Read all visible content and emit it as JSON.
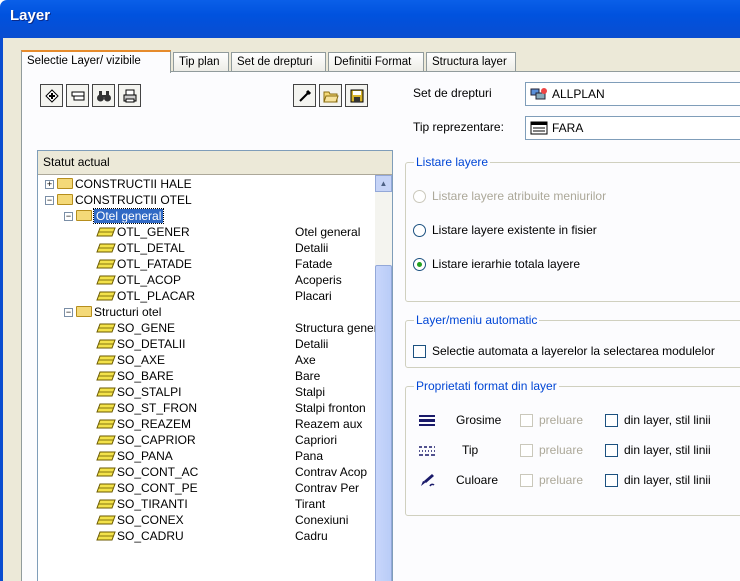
{
  "window": {
    "title": "Layer"
  },
  "tabs": [
    {
      "label": "Selectie Layer/ vizibile"
    },
    {
      "label": "Tip plan"
    },
    {
      "label": "Set de drepturi"
    },
    {
      "label": "Definitii Format"
    },
    {
      "label": "Structura layer"
    }
  ],
  "toolbar": {
    "icons": [
      "add-layer-icon",
      "list-icon",
      "binoculars-icon",
      "printer-icon",
      "eyedropper-icon",
      "open-folder-icon",
      "save-icon"
    ]
  },
  "tree": {
    "header": "Statut actual",
    "nodes": [
      {
        "label": "CONSTRUCTII HALE",
        "desc": ""
      },
      {
        "label": "CONSTRUCTII OTEL",
        "desc": ""
      },
      {
        "label": "Otel general",
        "desc": ""
      },
      {
        "label": "OTL_GENER",
        "desc": "Otel general"
      },
      {
        "label": "OTL_DETAL",
        "desc": "Detalii"
      },
      {
        "label": "OTL_FATADE",
        "desc": "Fatade"
      },
      {
        "label": "OTL_ACOP",
        "desc": "Acoperis"
      },
      {
        "label": "OTL_PLACAR",
        "desc": "Placari"
      },
      {
        "label": "Structuri otel",
        "desc": ""
      },
      {
        "label": "SO_GENE",
        "desc": "Structura generala"
      },
      {
        "label": "SO_DETALII",
        "desc": "Detalii"
      },
      {
        "label": "SO_AXE",
        "desc": "Axe"
      },
      {
        "label": "SO_BARE",
        "desc": "Bare"
      },
      {
        "label": "SO_STALPI",
        "desc": "Stalpi"
      },
      {
        "label": "SO_ST_FRON",
        "desc": "Stalpi fronton"
      },
      {
        "label": "SO_REAZEM",
        "desc": "Reazem aux"
      },
      {
        "label": "SO_CAPRIOR",
        "desc": "Capriori"
      },
      {
        "label": "SO_PANA",
        "desc": "Pana"
      },
      {
        "label": "SO_CONT_AC",
        "desc": "Contrav Acop"
      },
      {
        "label": "SO_CONT_PE",
        "desc": "Contrav Per"
      },
      {
        "label": "SO_TIRANTI",
        "desc": "Tirant"
      },
      {
        "label": "SO_CONEX",
        "desc": "Conexiuni"
      },
      {
        "label": "SO_CADRU",
        "desc": "Cadru"
      }
    ]
  },
  "rights": {
    "label": "Set de drepturi",
    "value": "ALLPLAN"
  },
  "representation": {
    "label": "Tip reprezentare:",
    "value": "FARA"
  },
  "listing": {
    "title": "Listare layere",
    "options": [
      {
        "label": "Listare layere atribuite meniurilor",
        "enabled": false,
        "selected": false
      },
      {
        "label": "Listare layere existente in fisier",
        "enabled": true,
        "selected": false
      },
      {
        "label": "Listare ierarhie totala layere",
        "enabled": true,
        "selected": true
      }
    ]
  },
  "automatic": {
    "title": "Layer/meniu automatic",
    "checkbox": "Selectie automata a layerelor la selectarea modulelor"
  },
  "format": {
    "title": "Proprietati format din layer",
    "rows": [
      {
        "label": "Grosime",
        "take": "preluare",
        "from": "din layer, stil linii"
      },
      {
        "label": "Tip",
        "take": "preluare",
        "from": "din layer, stil linii"
      },
      {
        "label": "Culoare",
        "take": "preluare",
        "from": "din layer, stil linii"
      }
    ]
  },
  "colors": {
    "title_bar": "#0052de",
    "group_title": "#0046d5",
    "selected": "#316ac5",
    "folder": "#f4d978"
  }
}
